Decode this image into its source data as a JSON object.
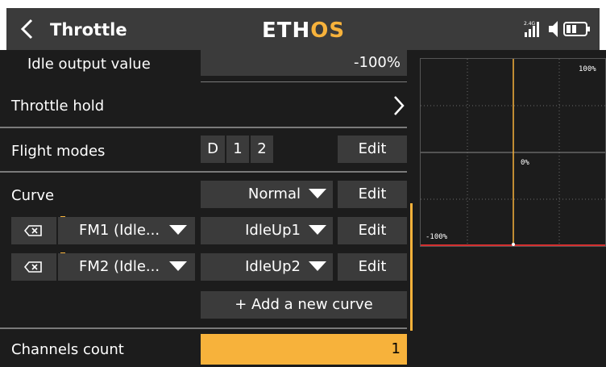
{
  "header": {
    "title": "Throttle",
    "logo": {
      "main": "ETH",
      "accent": "OS"
    },
    "rf_band": "2.4G"
  },
  "settings": {
    "idle_output": {
      "label": "Idle output value",
      "value": "-100%"
    },
    "throttle_hold": {
      "label": "Throttle hold"
    },
    "flight_modes": {
      "label": "Flight modes",
      "modes": [
        "D",
        "1",
        "2"
      ],
      "edit_label": "Edit"
    },
    "curve": {
      "label": "Curve",
      "value": "Normal",
      "edit_label": "Edit",
      "entries": [
        {
          "flight_mode": "FM1 (Idle...",
          "curve": "IdleUp1",
          "edit_label": "Edit"
        },
        {
          "flight_mode": "FM2 (Idle...",
          "curve": "IdleUp2",
          "edit_label": "Edit"
        }
      ],
      "add_label": "+ Add a new curve"
    },
    "channels_count": {
      "label": "Channels count",
      "value": "1"
    }
  },
  "graph": {
    "top_label": "100%",
    "center_label": "0%",
    "bottom_label": "-100%"
  },
  "colors": {
    "accent": "#f7b23b",
    "background": "#1c1c1c",
    "field": "#3b3b3b",
    "curve_line": "#d32f2f"
  }
}
